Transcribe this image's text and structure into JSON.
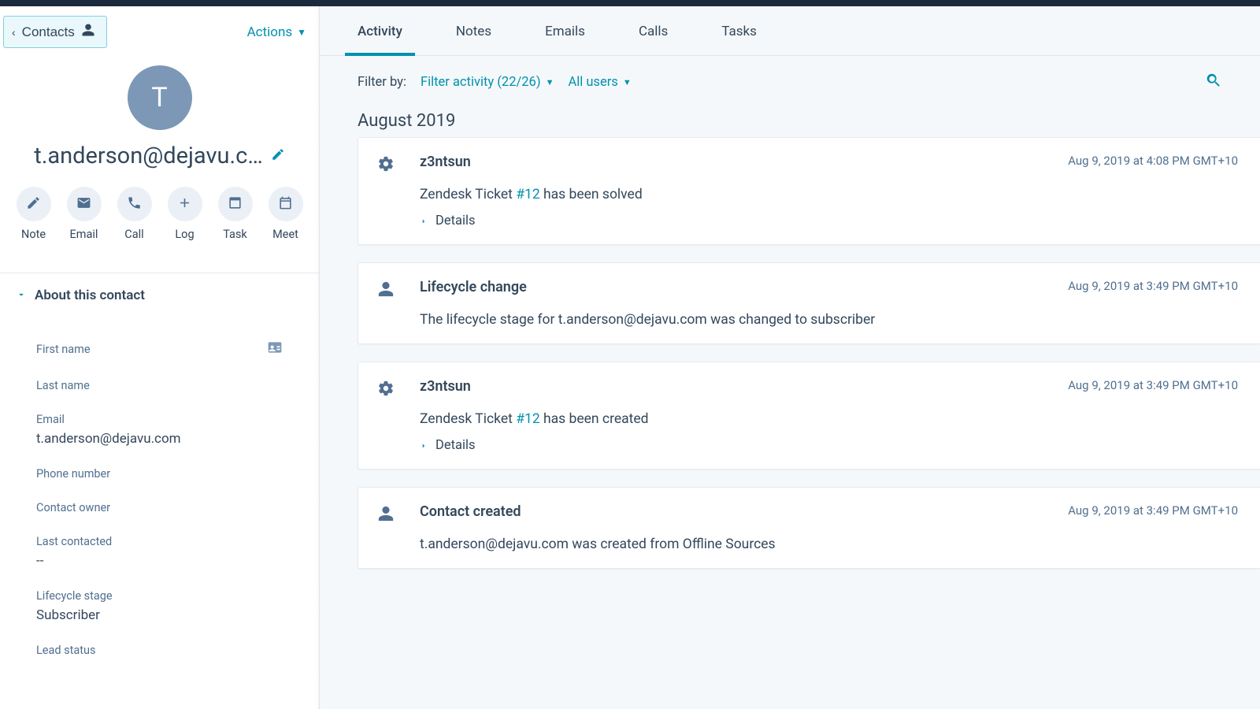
{
  "sidebar": {
    "back_label": "Contacts",
    "actions_label": "Actions",
    "avatar_initial": "T",
    "display_name": "t.anderson@dejavu.c…",
    "quick_actions": {
      "note": "Note",
      "email": "Email",
      "call": "Call",
      "log": "Log",
      "task": "Task",
      "meet": "Meet"
    },
    "about_title": "About this contact",
    "fields": {
      "first_name": {
        "label": "First name",
        "value": ""
      },
      "last_name": {
        "label": "Last name",
        "value": ""
      },
      "email": {
        "label": "Email",
        "value": "t.anderson@dejavu.com"
      },
      "phone": {
        "label": "Phone number",
        "value": ""
      },
      "owner": {
        "label": "Contact owner",
        "value": ""
      },
      "last_contacted": {
        "label": "Last contacted",
        "value": "--"
      },
      "lifecycle": {
        "label": "Lifecycle stage",
        "value": "Subscriber"
      },
      "lead_status": {
        "label": "Lead status",
        "value": ""
      }
    }
  },
  "main": {
    "tabs": {
      "activity": "Activity",
      "notes": "Notes",
      "emails": "Emails",
      "calls": "Calls",
      "tasks": "Tasks"
    },
    "filter": {
      "label": "Filter by:",
      "activity": "Filter activity (22/26)",
      "users": "All users"
    },
    "month_heading": "August 2019",
    "cards": [
      {
        "icon": "gear",
        "title": "z3ntsun",
        "timestamp": "Aug 9, 2019 at 4:08 PM GMT+10",
        "body_prefix": "Zendesk Ticket ",
        "ticket": "#12",
        "body_suffix": " has been solved",
        "has_details": true,
        "details_label": "Details"
      },
      {
        "icon": "person",
        "title": "Lifecycle change",
        "timestamp": "Aug 9, 2019 at 3:49 PM GMT+10",
        "body_plain": "The lifecycle stage for t.anderson@dejavu.com was changed to subscriber",
        "has_details": false
      },
      {
        "icon": "gear",
        "title": "z3ntsun",
        "timestamp": "Aug 9, 2019 at 3:49 PM GMT+10",
        "body_prefix": "Zendesk Ticket ",
        "ticket": "#12",
        "body_suffix": " has been created",
        "has_details": true,
        "details_label": "Details"
      },
      {
        "icon": "person",
        "title": "Contact created",
        "timestamp": "Aug 9, 2019 at 3:49 PM GMT+10",
        "body_plain": "t.anderson@dejavu.com was created from Offline Sources",
        "has_details": false
      }
    ]
  }
}
